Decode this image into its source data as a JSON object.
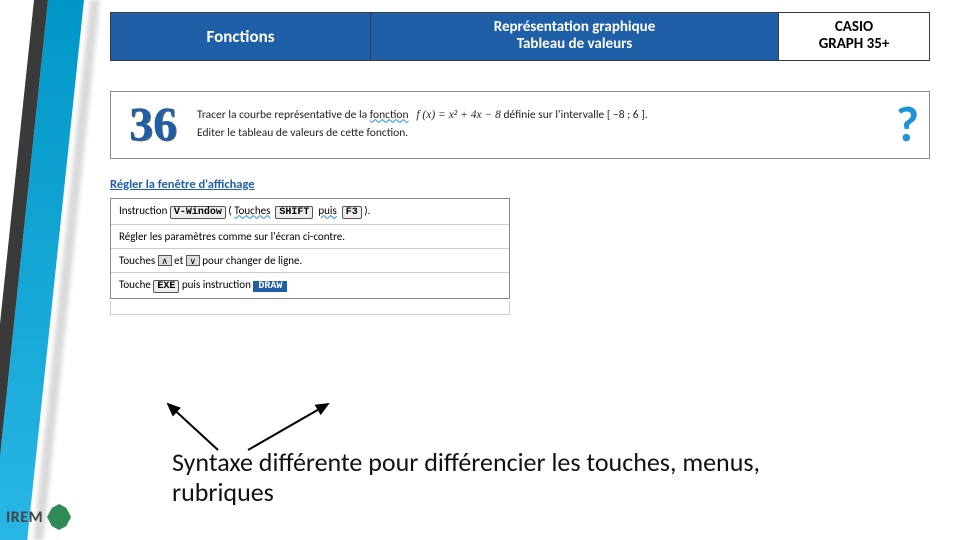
{
  "header": {
    "col1": "Fonctions",
    "col2_line1": "Représentation graphique",
    "col2_line2": "Tableau de valeurs",
    "col3_line1": "CASIO",
    "col3_line2": "GRAPH 35+"
  },
  "problem": {
    "number": "36",
    "line1_a": "Tracer la courbe représentative de la ",
    "line1_b": "fonction",
    "line1_formula": "f (x) = x² + 4x − 8",
    "line1_c": " définie sur l'intervalle ",
    "line1_interval": "[ −8 ; 6 ]",
    "line2": "Editer le tableau de valeurs de cette fonction.",
    "qmark": "?"
  },
  "section": "Régler la fenêtre d'affichage",
  "instr": {
    "r1_a": "Instruction ",
    "r1_key1": "V-Window",
    "r1_b": " ( ",
    "r1_touches": "Touches",
    "r1_key2": "SHIFT",
    "r1_puis": "puis",
    "r1_key3": "F3",
    "r1_c": " ).",
    "r2": "Régler les paramètres comme sur l'écran ci-contre.",
    "r3_a": "Touches ",
    "r3_up": "∧",
    "r3_et": " et ",
    "r3_down": "∨",
    "r3_b": " pour changer de ligne.",
    "r4_a": "Touche ",
    "r4_key1": "EXE",
    "r4_b": " puis instruction ",
    "r4_key2": "DRAW"
  },
  "caption": "Syntaxe différente pour différencier les touches, menus, rubriques",
  "logo": "IREM"
}
